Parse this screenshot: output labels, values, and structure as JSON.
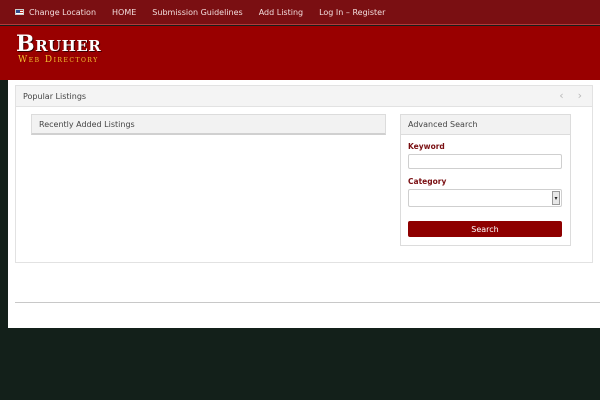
{
  "nav": {
    "change_location": "Change Location",
    "items": [
      "HOME",
      "Submission Guidelines",
      "Add Listing",
      "Log In – Register"
    ]
  },
  "logo": {
    "title": "Bruher",
    "subtitle": "Web Directory"
  },
  "popular": {
    "title": "Popular Listings",
    "prev_icon": "chevron-left",
    "next_icon": "chevron-right"
  },
  "recent": {
    "title": "Recently Added Listings"
  },
  "advanced_search": {
    "title": "Advanced Search",
    "keyword_label": "Keyword",
    "keyword_value": "",
    "category_label": "Category",
    "category_value": "",
    "search_button": "Search"
  },
  "colors": {
    "nav_bg": "#7a0f12",
    "header_bg": "#990000",
    "accent": "#8e0000",
    "logo_sub": "#f2c230",
    "page_bg": "#13201a"
  }
}
